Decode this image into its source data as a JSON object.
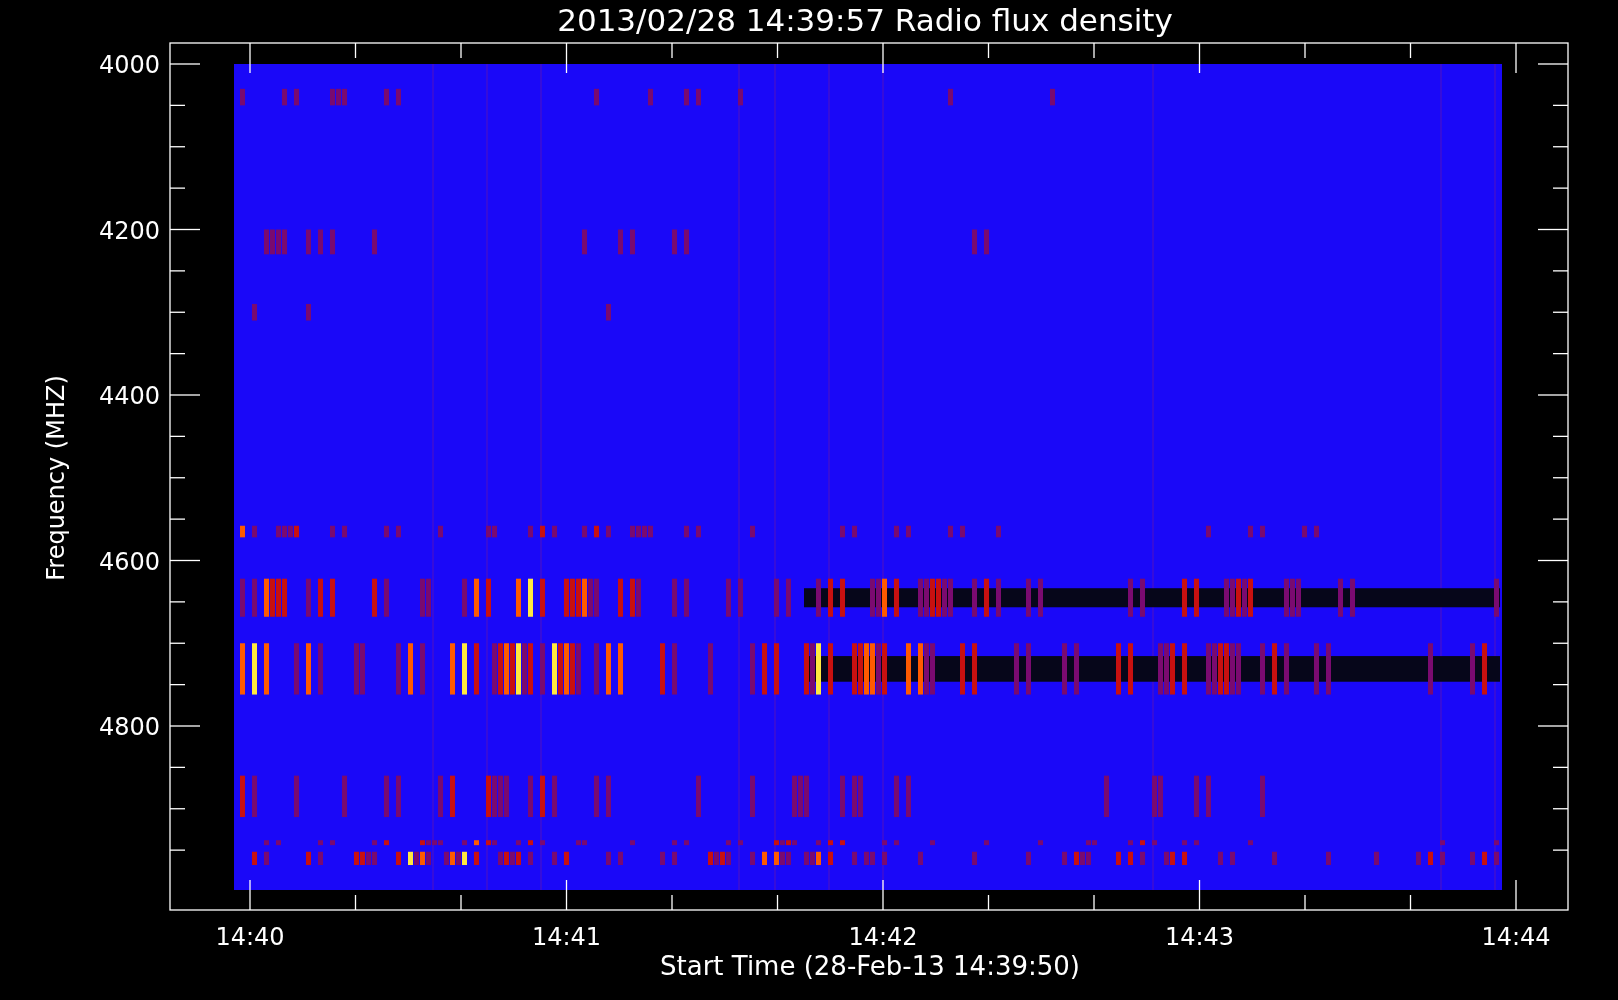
{
  "title": "2013/02/28 14:39:57 Radio flux density",
  "plot": {
    "ylabel": "Frequency (MHZ)",
    "xlabel": "Start Time (28-Feb-13 14:39:50)",
    "yticks": [
      "4000",
      "4200",
      "4400",
      "4600",
      "4800"
    ],
    "xticks": [
      "14:40",
      "14:41",
      "14:42",
      "14:43",
      "14:44"
    ]
  }
}
